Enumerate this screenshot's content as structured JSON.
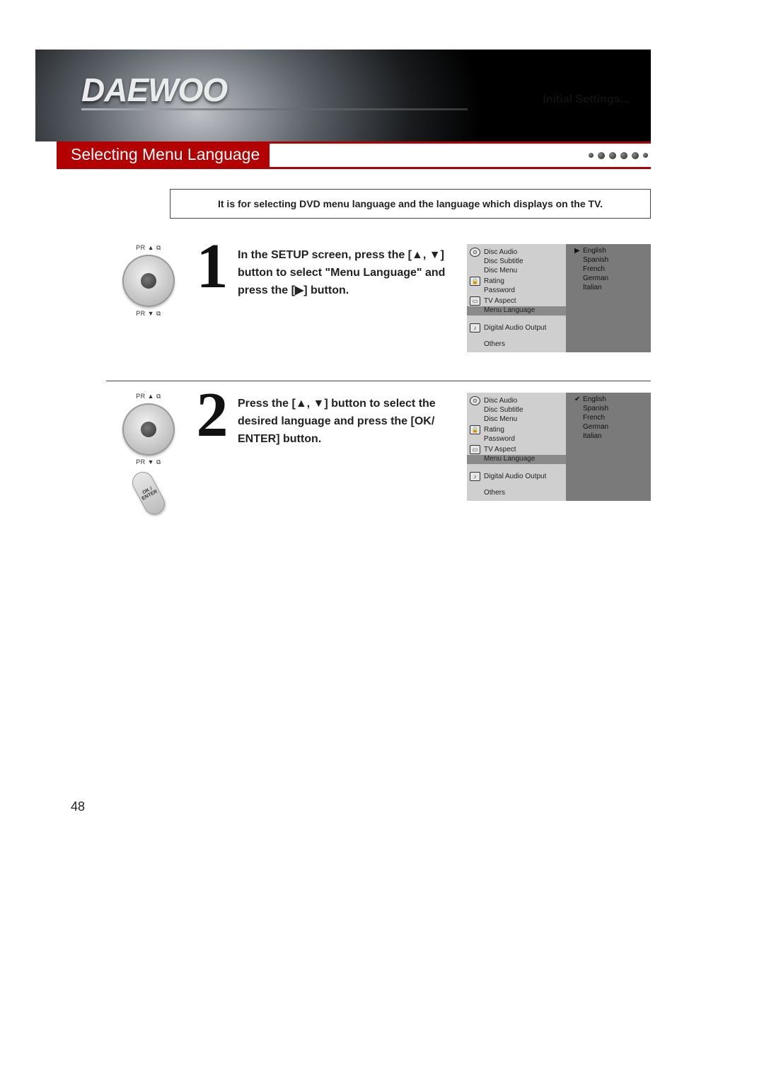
{
  "brand": "DAEWOO",
  "breadcrumb": "Initial Settings...",
  "section_title": "Selecting Menu Language",
  "intro": "It is for selecting DVD menu language and the language which displays on the TV.",
  "page_number": "48",
  "remote": {
    "pr_up": "PR ▲ ⧉",
    "pr_down": "PR ▼ ⧉",
    "ok": "OK / ENTER"
  },
  "steps": [
    {
      "num": "1",
      "text_parts": {
        "a": "In the SETUP screen, press the [",
        "arrows": "▲, ▼",
        "b": "] button to select \"Menu Language\" and press the [",
        "right": "▶",
        "c": "] button."
      },
      "osd": {
        "left_items": [
          "Disc Audio",
          "Disc Subtitle",
          "Disc Menu",
          "Rating",
          "Password",
          "TV Aspect",
          "Menu Language",
          "Digital Audio Output",
          "Others"
        ],
        "highlight": "Menu Language",
        "right_items": [
          "English",
          "Spanish",
          "French",
          "German",
          "Italian"
        ],
        "right_marker": "▶",
        "right_selected": "English"
      }
    },
    {
      "num": "2",
      "text_parts": {
        "a": "Press the [",
        "arrows": "▲, ▼",
        "b": "] button to select the desired language and press the [OK/ ENTER] button."
      },
      "osd": {
        "left_items": [
          "Disc Audio",
          "Disc Subtitle",
          "Disc Menu",
          "Rating",
          "Password",
          "TV Aspect",
          "Menu Language",
          "Digital Audio Output",
          "Others"
        ],
        "highlight": "Menu Language",
        "right_items": [
          "English",
          "Spanish",
          "French",
          "German",
          "Italian"
        ],
        "right_marker": "✔",
        "right_selected": "English"
      }
    }
  ]
}
